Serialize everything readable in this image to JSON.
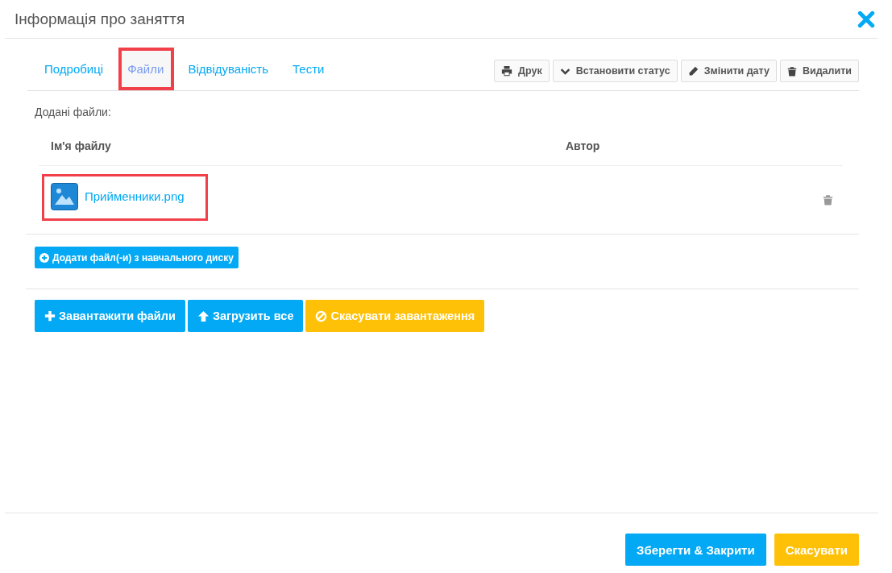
{
  "window": {
    "title": "Інформація про заняття"
  },
  "tabs": [
    {
      "label": "Подробиці",
      "selected": false,
      "highlighted": false
    },
    {
      "label": "Файли",
      "selected": true,
      "highlighted": true
    },
    {
      "label": "Відвідуваність",
      "selected": false,
      "highlighted": false
    },
    {
      "label": "Тести",
      "selected": false,
      "highlighted": false
    }
  ],
  "toolbar": [
    {
      "kind": "print",
      "label": "Друк"
    },
    {
      "kind": "status",
      "label": "Встановити статус"
    },
    {
      "kind": "date",
      "label": "Змінити дату"
    },
    {
      "kind": "delete",
      "label": "Видалити"
    }
  ],
  "files_section": {
    "heading": "Додані файли:",
    "columns": [
      "Ім'я файлу",
      "Автор"
    ],
    "rows": [
      {
        "name": "Прийменники.png",
        "highlighted": true
      }
    ]
  },
  "add_from_disk_button": "Додати файл(-и) з навчального диску",
  "upload_buttons": [
    {
      "kind": "add",
      "label": "Завантажити файли"
    },
    {
      "kind": "upload",
      "label": "Загрузить все"
    },
    {
      "kind": "cancel",
      "label": "Скасувати завантаження"
    }
  ],
  "footer_buttons": [
    {
      "kind": "primary",
      "label": "Зберегти & Закрити"
    },
    {
      "kind": "warning",
      "label": "Скасувати"
    }
  ]
}
